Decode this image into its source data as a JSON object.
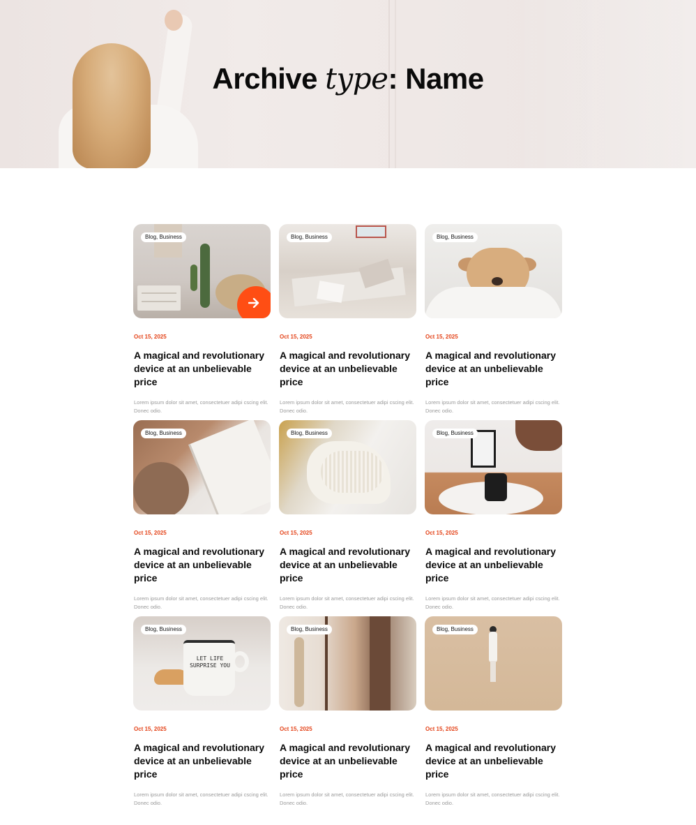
{
  "hero": {
    "title_part1": "Archive ",
    "title_italic": "type",
    "title_part2": ": Name"
  },
  "theme": {
    "accent": "#E4441A",
    "arrow_button": "#FF4E14"
  },
  "cards": [
    {
      "tag": "Blog, Business",
      "date": "Oct 15, 2025",
      "title": "A magical and revolutionary device at an unbelievable price",
      "excerpt": "Lorem ipsum dolor sit amet, consectetuer adipi cscing elit. Donec odio.",
      "image_icon": "cactus-room-photo",
      "has_arrow": true
    },
    {
      "tag": "Blog, Business",
      "date": "Oct 15, 2025",
      "title": "A magical and revolutionary device at an unbelievable price",
      "excerpt": "Lorem ipsum dolor sit amet, consectetuer adipi cscing elit. Donec odio.",
      "image_icon": "rubble-photo"
    },
    {
      "tag": "Blog, Business",
      "date": "Oct 15, 2025",
      "title": "A magical and revolutionary device at an unbelievable price",
      "excerpt": "Lorem ipsum dolor sit amet, consectetuer adipi cscing elit. Donec odio.",
      "image_icon": "puppy-photo"
    },
    {
      "tag": "Blog, Business",
      "date": "Oct 15, 2025",
      "title": "A magical and revolutionary device at an unbelievable price",
      "excerpt": "Lorem ipsum dolor sit amet, consectetuer adipi cscing elit. Donec odio.",
      "image_icon": "book-knit-photo"
    },
    {
      "tag": "Blog, Business",
      "date": "Oct 15, 2025",
      "title": "A magical and revolutionary device at an unbelievable price",
      "excerpt": "Lorem ipsum dolor sit amet, consectetuer adipi cscing elit. Donec odio.",
      "image_icon": "fabric-photo"
    },
    {
      "tag": "Blog, Business",
      "date": "Oct 15, 2025",
      "title": "A magical and revolutionary device at an unbelievable price",
      "excerpt": "Lorem ipsum dolor sit amet, consectetuer adipi cscing elit. Donec odio.",
      "image_icon": "room-boots-photo"
    },
    {
      "tag": "Blog, Business",
      "date": "Oct 15, 2025",
      "title": "A magical and revolutionary device at an unbelievable price",
      "excerpt": "Lorem ipsum dolor sit amet, consectetuer adipi cscing elit. Donec odio.",
      "image_icon": "mug-photo",
      "mug_text": "LET LIFE SURPRISE YOU"
    },
    {
      "tag": "Blog, Business",
      "date": "Oct 15, 2025",
      "title": "A magical and revolutionary device at an unbelievable price",
      "excerpt": "Lorem ipsum dolor sit amet, consectetuer adipi cscing elit. Donec odio.",
      "image_icon": "clothes-rack-photo"
    },
    {
      "tag": "Blog, Business",
      "date": "Oct 15, 2025",
      "title": "A magical and revolutionary device at an unbelievable price",
      "excerpt": "Lorem ipsum dolor sit amet, consectetuer adipi cscing elit. Donec odio.",
      "image_icon": "desert-walk-photo"
    }
  ]
}
